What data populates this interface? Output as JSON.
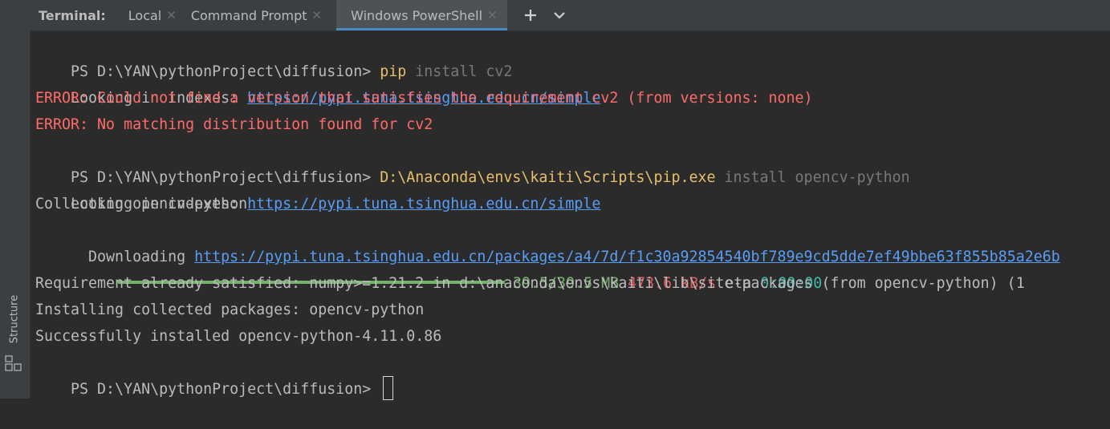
{
  "tabbar": {
    "title": "Terminal:",
    "tabs": [
      {
        "label": "Local"
      },
      {
        "label": "Command Prompt"
      },
      {
        "label": "Windows PowerShell"
      }
    ],
    "active_tab": "Windows PowerShell"
  },
  "sidebar": {
    "structure_label": "Structure"
  },
  "terminal": {
    "prompt": "PS D:\\YAN\\pythonProject\\diffusion> ",
    "lines": {
      "l1": {
        "cmd": "pip",
        "args": " install cv2"
      },
      "l2": {
        "text": "Looking in indexes: ",
        "link": "https://pypi.tuna.tsinghua.edu.cn/simple"
      },
      "l3": {
        "text": "ERROR: Could not find a version that satisfies the requirement cv2 (from versions: none)"
      },
      "l4": {
        "text": "ERROR: No matching distribution found for cv2"
      },
      "l5": {
        "cmd": "D:\\Anaconda\\envs\\kaiti\\Scripts\\pip.exe",
        "args": " install opencv-python"
      },
      "l6": {
        "text": "Looking in indexes: ",
        "link": "https://pypi.tuna.tsinghua.edu.cn/simple"
      },
      "l7": {
        "text": "Collecting opencv-python"
      },
      "l8": {
        "text": "  Downloading ",
        "link": "https://pypi.tuna.tsinghua.edu.cn/packages/a4/7d/f1c30a92854540bf789e9cd5dde7ef49bbe63f855b85a2e6b"
      },
      "l9": {
        "progress_fraction": 1.0,
        "size": "39.5/39.5 MB",
        "speed": "473.6 kB/s",
        "eta_label": "eta",
        "eta": "0:00:00"
      },
      "l10": {
        "text": "Requirement already satisfied: numpy>=1.21.2 in d:\\anaconda\\envs\\kaiti\\lib\\site-packages (from opencv-python) (1"
      },
      "l11": {
        "text": "Installing collected packages: opencv-python"
      },
      "l12": {
        "text": "Successfully installed opencv-python-4.11.0.86"
      }
    }
  },
  "icons": {
    "close": "close-icon",
    "add": "add-icon",
    "chevron": "chevron-down-icon",
    "structure": "structure-icon"
  },
  "colors": {
    "background": "#2b2b2b",
    "command": "#e8bf6a",
    "error": "#ff6b68",
    "link": "#589df6",
    "progress": "#73b36a",
    "speed": "#e45a5a",
    "eta": "#3fb6a8"
  }
}
